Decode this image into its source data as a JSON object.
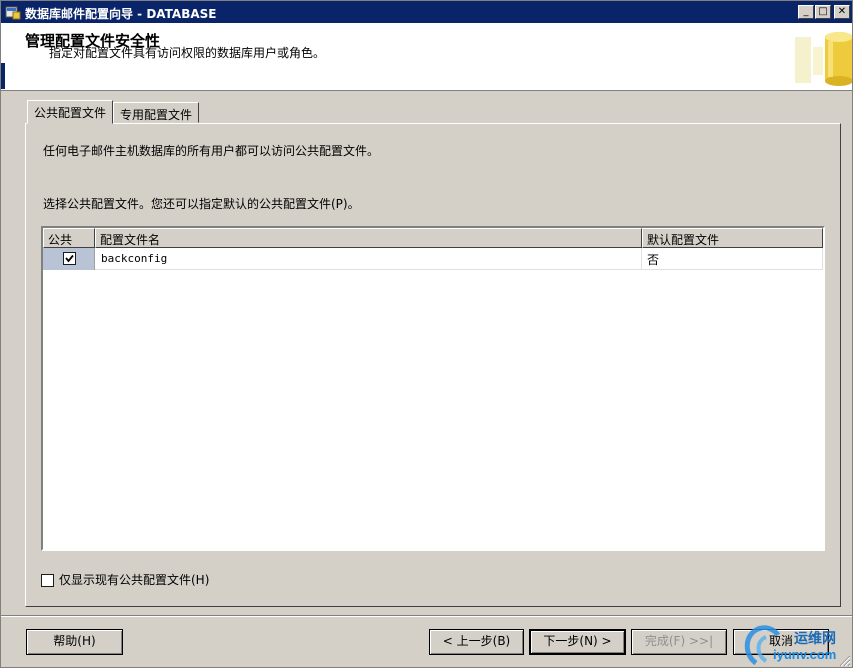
{
  "window": {
    "title": "数据库邮件配置向导 - DATABASE",
    "min_glyph": "_",
    "max_glyph": "□",
    "close_glyph": "✕"
  },
  "header": {
    "title": "管理配置文件安全性",
    "description": "指定对配置文件具有访问权限的数据库用户或角色。"
  },
  "tabs": [
    {
      "label": "公共配置文件",
      "active": true
    },
    {
      "label": "专用配置文件",
      "active": false
    }
  ],
  "panel": {
    "intro": "任何电子邮件主机数据库的所有用户都可以访问公共配置文件。",
    "instruction": "选择公共配置文件。您还可以指定默认的公共配置文件(P)。"
  },
  "grid": {
    "columns": [
      "公共",
      "配置文件名",
      "默认配置文件"
    ],
    "rows": [
      {
        "public": true,
        "profile_name": "backconfig",
        "default": "否"
      }
    ]
  },
  "show_existing_only": {
    "label": "仅显示现有公共配置文件(H)",
    "checked": false
  },
  "buttons": {
    "help": "帮助(H)",
    "back": "< 上一步(B)",
    "next": "下一步(N) >",
    "finish": "完成(F) >>|",
    "cancel": "取消"
  },
  "watermark": {
    "text1": "运维网",
    "text2": "iyunv.com"
  },
  "colors": {
    "titlebar": "#0a246a",
    "face": "#d4d0c8",
    "selection": "#b9c3d6"
  }
}
